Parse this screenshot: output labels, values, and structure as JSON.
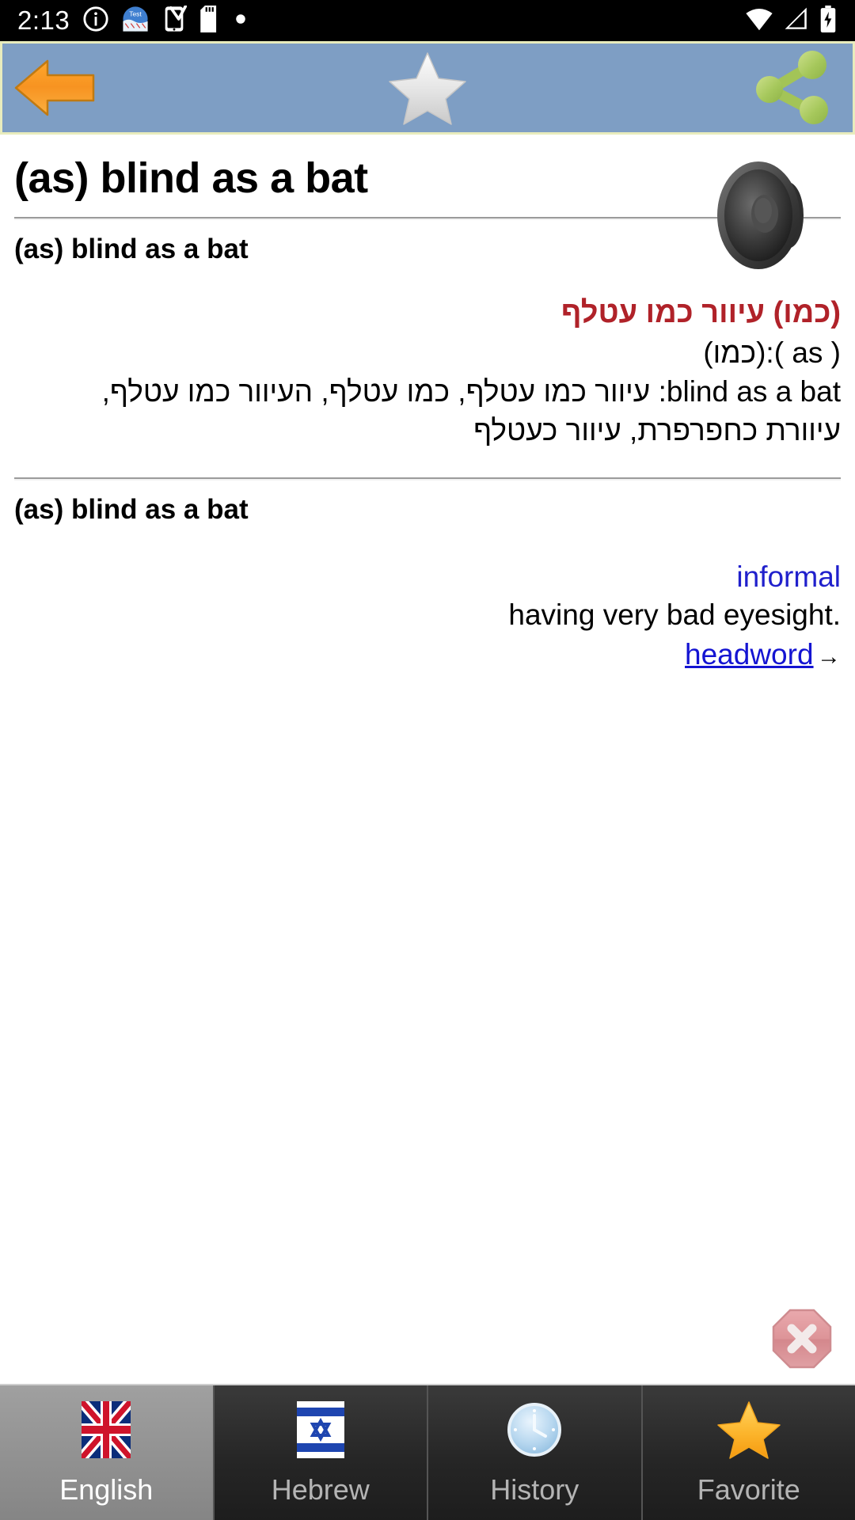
{
  "status_bar": {
    "time": "2:13",
    "left_icons": [
      "info-icon",
      "test-app-icon",
      "phone-check-icon",
      "sd-card-icon",
      "dot-icon"
    ],
    "right_icons": [
      "wifi-icon",
      "signal-icon",
      "battery-charging-icon"
    ]
  },
  "toolbar": {
    "background": "#7e9ec4",
    "border": "#e8ecbd",
    "back_label": "Back",
    "favorite_label": "Favorite",
    "share_label": "Share"
  },
  "entry": {
    "title": "(as) blind as a bat",
    "speaker_label": "Pronounce"
  },
  "translation_section": {
    "headword": "(as) blind as a bat",
    "hebrew_headline": "(כמו) עיוור כמו עטלף",
    "hebrew_pronunciation": "( as ):(כמו)",
    "hebrew_body_line1": "blind as a bat: עיוור כמו עטלף, כמו עטלף, העיוור כמו עטלף,",
    "hebrew_body_line2": "עיוורת כחפרפרת, עיוור כעטלף"
  },
  "definition_section": {
    "headword": "(as) blind as a bat",
    "register": "informal",
    "definition": ".having very bad eyesight",
    "link_text": "headword",
    "link_arrow": "→"
  },
  "close_button": {
    "label": "Close",
    "color": "#d98b8f"
  },
  "tabs": [
    {
      "label": "English",
      "icon": "uk-flag-icon",
      "active": true
    },
    {
      "label": "Hebrew",
      "icon": "israel-flag-icon",
      "active": false
    },
    {
      "label": "History",
      "icon": "clock-icon",
      "active": false
    },
    {
      "label": "Favorite",
      "icon": "star-icon",
      "active": false
    }
  ]
}
